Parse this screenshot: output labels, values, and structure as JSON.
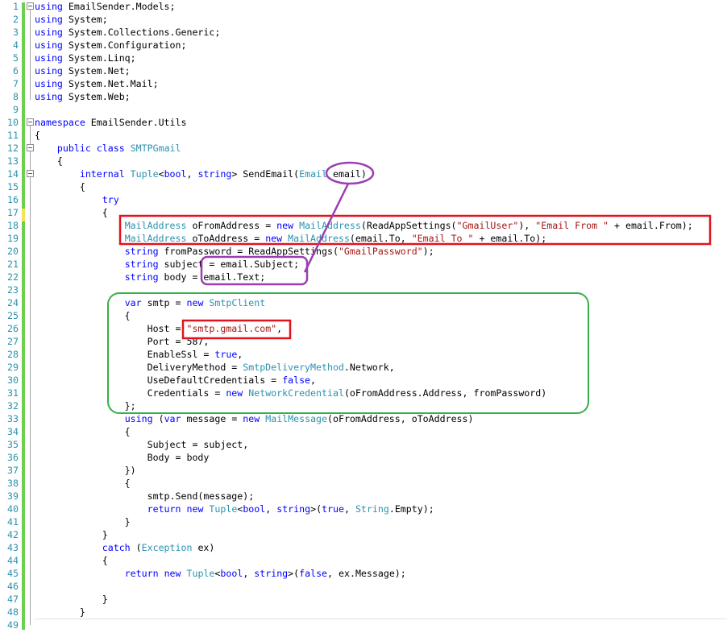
{
  "lines": [
    {
      "n": "1",
      "segs": [
        {
          "c": "k",
          "v": "using"
        },
        {
          "c": "",
          "v": " EmailSender.Models;"
        }
      ]
    },
    {
      "n": "2",
      "segs": [
        {
          "c": "k",
          "v": "using"
        },
        {
          "c": "",
          "v": " System;"
        }
      ]
    },
    {
      "n": "3",
      "segs": [
        {
          "c": "k",
          "v": "using"
        },
        {
          "c": "",
          "v": " System.Collections.Generic;"
        }
      ]
    },
    {
      "n": "4",
      "segs": [
        {
          "c": "k",
          "v": "using"
        },
        {
          "c": "",
          "v": " System.Configuration;"
        }
      ]
    },
    {
      "n": "5",
      "segs": [
        {
          "c": "k",
          "v": "using"
        },
        {
          "c": "",
          "v": " System.Linq;"
        }
      ]
    },
    {
      "n": "6",
      "segs": [
        {
          "c": "k",
          "v": "using"
        },
        {
          "c": "",
          "v": " System.Net;"
        }
      ]
    },
    {
      "n": "7",
      "segs": [
        {
          "c": "k",
          "v": "using"
        },
        {
          "c": "",
          "v": " System.Net.Mail;"
        }
      ]
    },
    {
      "n": "8",
      "segs": [
        {
          "c": "k",
          "v": "using"
        },
        {
          "c": "",
          "v": " System.Web;"
        }
      ]
    },
    {
      "n": "9",
      "segs": []
    },
    {
      "n": "10",
      "segs": [
        {
          "c": "k",
          "v": "namespace"
        },
        {
          "c": "",
          "v": " EmailSender.Utils"
        }
      ]
    },
    {
      "n": "11",
      "segs": [
        {
          "c": "",
          "v": "{"
        }
      ]
    },
    {
      "n": "12",
      "segs": [
        {
          "c": "",
          "v": "    "
        },
        {
          "c": "k",
          "v": "public"
        },
        {
          "c": "",
          "v": " "
        },
        {
          "c": "k",
          "v": "class"
        },
        {
          "c": "",
          "v": " "
        },
        {
          "c": "t",
          "v": "SMTPGmail"
        }
      ]
    },
    {
      "n": "13",
      "segs": [
        {
          "c": "",
          "v": "    {"
        }
      ]
    },
    {
      "n": "14",
      "segs": [
        {
          "c": "",
          "v": "        "
        },
        {
          "c": "k",
          "v": "internal"
        },
        {
          "c": "",
          "v": " "
        },
        {
          "c": "t",
          "v": "Tuple"
        },
        {
          "c": "",
          "v": "<"
        },
        {
          "c": "k",
          "v": "bool"
        },
        {
          "c": "",
          "v": ", "
        },
        {
          "c": "k",
          "v": "string"
        },
        {
          "c": "",
          "v": "> SendEmail("
        },
        {
          "c": "t",
          "v": "Email"
        },
        {
          "c": "",
          "v": " email)"
        }
      ]
    },
    {
      "n": "15",
      "segs": [
        {
          "c": "",
          "v": "        {"
        }
      ]
    },
    {
      "n": "16",
      "segs": [
        {
          "c": "",
          "v": "            "
        },
        {
          "c": "k",
          "v": "try"
        }
      ]
    },
    {
      "n": "17",
      "segs": [
        {
          "c": "",
          "v": "            {"
        }
      ]
    },
    {
      "n": "18",
      "segs": [
        {
          "c": "",
          "v": "                "
        },
        {
          "c": "t",
          "v": "MailAddress"
        },
        {
          "c": "",
          "v": " oFromAddress = "
        },
        {
          "c": "k",
          "v": "new"
        },
        {
          "c": "",
          "v": " "
        },
        {
          "c": "t",
          "v": "MailAddress"
        },
        {
          "c": "",
          "v": "(ReadAppSettings("
        },
        {
          "c": "s",
          "v": "\"GmailUser\""
        },
        {
          "c": "",
          "v": "), "
        },
        {
          "c": "s",
          "v": "\"Email From \""
        },
        {
          "c": "",
          "v": " + email.From);"
        }
      ]
    },
    {
      "n": "19",
      "segs": [
        {
          "c": "",
          "v": "                "
        },
        {
          "c": "t",
          "v": "MailAddress"
        },
        {
          "c": "",
          "v": " oToAddress = "
        },
        {
          "c": "k",
          "v": "new"
        },
        {
          "c": "",
          "v": " "
        },
        {
          "c": "t",
          "v": "MailAddress"
        },
        {
          "c": "",
          "v": "(email.To, "
        },
        {
          "c": "s",
          "v": "\"Email To \""
        },
        {
          "c": "",
          "v": " + email.To);"
        }
      ]
    },
    {
      "n": "20",
      "segs": [
        {
          "c": "",
          "v": "                "
        },
        {
          "c": "k",
          "v": "string"
        },
        {
          "c": "",
          "v": " fromPassword = ReadAppSettings("
        },
        {
          "c": "s",
          "v": "\"GmailPassword\""
        },
        {
          "c": "",
          "v": ");"
        }
      ]
    },
    {
      "n": "21",
      "segs": [
        {
          "c": "",
          "v": "                "
        },
        {
          "c": "k",
          "v": "string"
        },
        {
          "c": "",
          "v": " subject = email.Subject;"
        }
      ]
    },
    {
      "n": "22",
      "segs": [
        {
          "c": "",
          "v": "                "
        },
        {
          "c": "k",
          "v": "string"
        },
        {
          "c": "",
          "v": " body = email.Text;"
        }
      ]
    },
    {
      "n": "23",
      "segs": []
    },
    {
      "n": "24",
      "segs": [
        {
          "c": "",
          "v": "                "
        },
        {
          "c": "k",
          "v": "var"
        },
        {
          "c": "",
          "v": " smtp = "
        },
        {
          "c": "k",
          "v": "new"
        },
        {
          "c": "",
          "v": " "
        },
        {
          "c": "t",
          "v": "SmtpClient"
        }
      ]
    },
    {
      "n": "25",
      "segs": [
        {
          "c": "",
          "v": "                {"
        }
      ]
    },
    {
      "n": "26",
      "segs": [
        {
          "c": "",
          "v": "                    Host = "
        },
        {
          "c": "s",
          "v": "\"smtp.gmail.com\""
        },
        {
          "c": "",
          "v": ","
        }
      ]
    },
    {
      "n": "27",
      "segs": [
        {
          "c": "",
          "v": "                    Port = 587,"
        }
      ]
    },
    {
      "n": "28",
      "segs": [
        {
          "c": "",
          "v": "                    EnableSsl = "
        },
        {
          "c": "k",
          "v": "true"
        },
        {
          "c": "",
          "v": ","
        }
      ]
    },
    {
      "n": "29",
      "segs": [
        {
          "c": "",
          "v": "                    DeliveryMethod = "
        },
        {
          "c": "t",
          "v": "SmtpDeliveryMethod"
        },
        {
          "c": "",
          "v": ".Network,"
        }
      ]
    },
    {
      "n": "30",
      "segs": [
        {
          "c": "",
          "v": "                    UseDefaultCredentials = "
        },
        {
          "c": "k",
          "v": "false"
        },
        {
          "c": "",
          "v": ","
        }
      ]
    },
    {
      "n": "31",
      "segs": [
        {
          "c": "",
          "v": "                    Credentials = "
        },
        {
          "c": "k",
          "v": "new"
        },
        {
          "c": "",
          "v": " "
        },
        {
          "c": "t",
          "v": "NetworkCredential"
        },
        {
          "c": "",
          "v": "(oFromAddress.Address, fromPassword)"
        }
      ]
    },
    {
      "n": "32",
      "segs": [
        {
          "c": "",
          "v": "                };"
        }
      ]
    },
    {
      "n": "33",
      "segs": [
        {
          "c": "",
          "v": "                "
        },
        {
          "c": "k",
          "v": "using"
        },
        {
          "c": "",
          "v": " ("
        },
        {
          "c": "k",
          "v": "var"
        },
        {
          "c": "",
          "v": " message = "
        },
        {
          "c": "k",
          "v": "new"
        },
        {
          "c": "",
          "v": " "
        },
        {
          "c": "t",
          "v": "MailMessage"
        },
        {
          "c": "",
          "v": "(oFromAddress, oToAddress)"
        }
      ]
    },
    {
      "n": "34",
      "segs": [
        {
          "c": "",
          "v": "                {"
        }
      ]
    },
    {
      "n": "35",
      "segs": [
        {
          "c": "",
          "v": "                    Subject = subject,"
        }
      ]
    },
    {
      "n": "36",
      "segs": [
        {
          "c": "",
          "v": "                    Body = body"
        }
      ]
    },
    {
      "n": "37",
      "segs": [
        {
          "c": "",
          "v": "                })"
        }
      ]
    },
    {
      "n": "38",
      "segs": [
        {
          "c": "",
          "v": "                {"
        }
      ]
    },
    {
      "n": "39",
      "segs": [
        {
          "c": "",
          "v": "                    smtp.Send(message);"
        }
      ]
    },
    {
      "n": "40",
      "segs": [
        {
          "c": "",
          "v": "                    "
        },
        {
          "c": "k",
          "v": "return"
        },
        {
          "c": "",
          "v": " "
        },
        {
          "c": "k",
          "v": "new"
        },
        {
          "c": "",
          "v": " "
        },
        {
          "c": "t",
          "v": "Tuple"
        },
        {
          "c": "",
          "v": "<"
        },
        {
          "c": "k",
          "v": "bool"
        },
        {
          "c": "",
          "v": ", "
        },
        {
          "c": "k",
          "v": "string"
        },
        {
          "c": "",
          "v": ">("
        },
        {
          "c": "k",
          "v": "true"
        },
        {
          "c": "",
          "v": ", "
        },
        {
          "c": "t",
          "v": "String"
        },
        {
          "c": "",
          "v": ".Empty);"
        }
      ]
    },
    {
      "n": "41",
      "segs": [
        {
          "c": "",
          "v": "                }"
        }
      ]
    },
    {
      "n": "42",
      "segs": [
        {
          "c": "",
          "v": "            }"
        }
      ]
    },
    {
      "n": "43",
      "segs": [
        {
          "c": "",
          "v": "            "
        },
        {
          "c": "k",
          "v": "catch"
        },
        {
          "c": "",
          "v": " ("
        },
        {
          "c": "t",
          "v": "Exception"
        },
        {
          "c": "",
          "v": " ex)"
        }
      ]
    },
    {
      "n": "44",
      "segs": [
        {
          "c": "",
          "v": "            {"
        }
      ]
    },
    {
      "n": "45",
      "segs": [
        {
          "c": "",
          "v": "                "
        },
        {
          "c": "k",
          "v": "return"
        },
        {
          "c": "",
          "v": " "
        },
        {
          "c": "k",
          "v": "new"
        },
        {
          "c": "",
          "v": " "
        },
        {
          "c": "t",
          "v": "Tuple"
        },
        {
          "c": "",
          "v": "<"
        },
        {
          "c": "k",
          "v": "bool"
        },
        {
          "c": "",
          "v": ", "
        },
        {
          "c": "k",
          "v": "string"
        },
        {
          "c": "",
          "v": ">("
        },
        {
          "c": "k",
          "v": "false"
        },
        {
          "c": "",
          "v": ", ex.Message);"
        }
      ]
    },
    {
      "n": "46",
      "segs": []
    },
    {
      "n": "47",
      "segs": [
        {
          "c": "",
          "v": "            }"
        }
      ]
    },
    {
      "n": "48",
      "segs": [
        {
          "c": "",
          "v": "        }"
        }
      ]
    },
    {
      "n": "49",
      "segs": []
    }
  ],
  "colors": {
    "keyword": "#0000ff",
    "type": "#2b91af",
    "string": "#a31515",
    "line_number": "#2b91af",
    "annotation_red": "#e0141e",
    "annotation_purple": "#9b3fb0",
    "annotation_green": "#36b14a"
  }
}
